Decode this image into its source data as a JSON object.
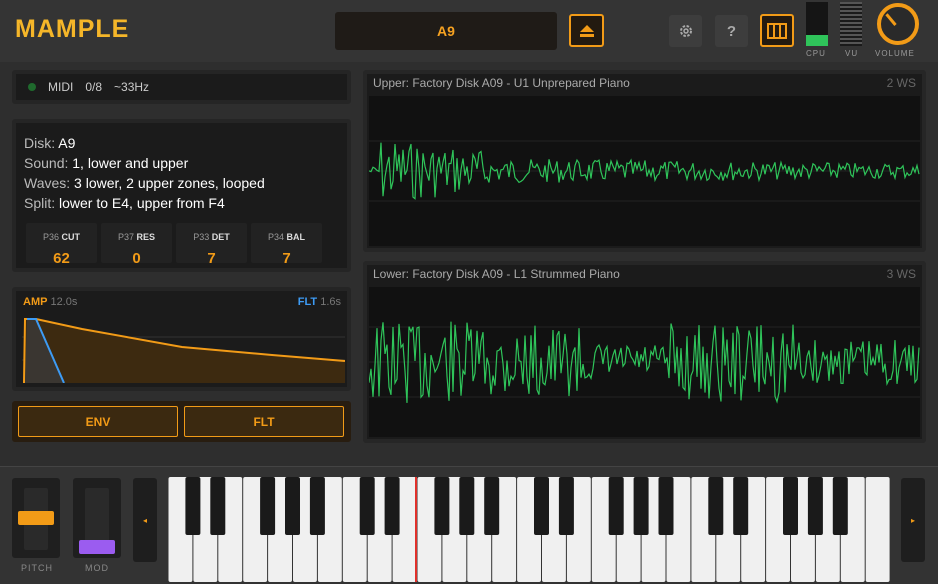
{
  "header": {
    "logo": "MAMPLE",
    "disk_display": "A9",
    "help_label": "?",
    "cpu_label": "CPU",
    "vu_label": "VU",
    "volume_label": "VOLUME",
    "cpu_level": 0.25
  },
  "midi": {
    "label": "MIDI",
    "notes": "0/8",
    "rate": "~33Hz"
  },
  "info": {
    "disk_key": "Disk:",
    "disk": "A9",
    "sound_key": "Sound:",
    "sound": "1, lower and upper",
    "waves_key": "Waves:",
    "waves": "3 lower, 2 upper zones, looped",
    "split_key": "Split:",
    "split": "lower to E4, upper from F4"
  },
  "params": [
    {
      "id": "P36",
      "name": "CUT",
      "value": "62"
    },
    {
      "id": "P37",
      "name": "RES",
      "value": "0"
    },
    {
      "id": "P33",
      "name": "DET",
      "value": "7"
    },
    {
      "id": "P34",
      "name": "BAL",
      "value": "7"
    }
  ],
  "envelope": {
    "amp_label": "AMP",
    "amp_time": "12.0s",
    "flt_label": "FLT",
    "flt_time": "1.6s"
  },
  "tabs": {
    "env": "ENV",
    "flt": "FLT"
  },
  "waves": {
    "upper": {
      "title": "Upper: Factory Disk A09 - U1 Unprepared Piano",
      "count": "2 WS"
    },
    "lower": {
      "title": "Lower: Factory Disk A09 - L1 Strummed Piano",
      "count": "3 WS"
    }
  },
  "controls": {
    "pitch_label": "PITCH",
    "mod_label": "MOD",
    "left_arrow": "◂",
    "right_arrow": "▸"
  },
  "colors": {
    "accent": "#f29b17",
    "wave": "#2fc45a",
    "filter": "#3d9bf4",
    "mod": "#9b5cf0",
    "playhead": "#e0302a"
  }
}
